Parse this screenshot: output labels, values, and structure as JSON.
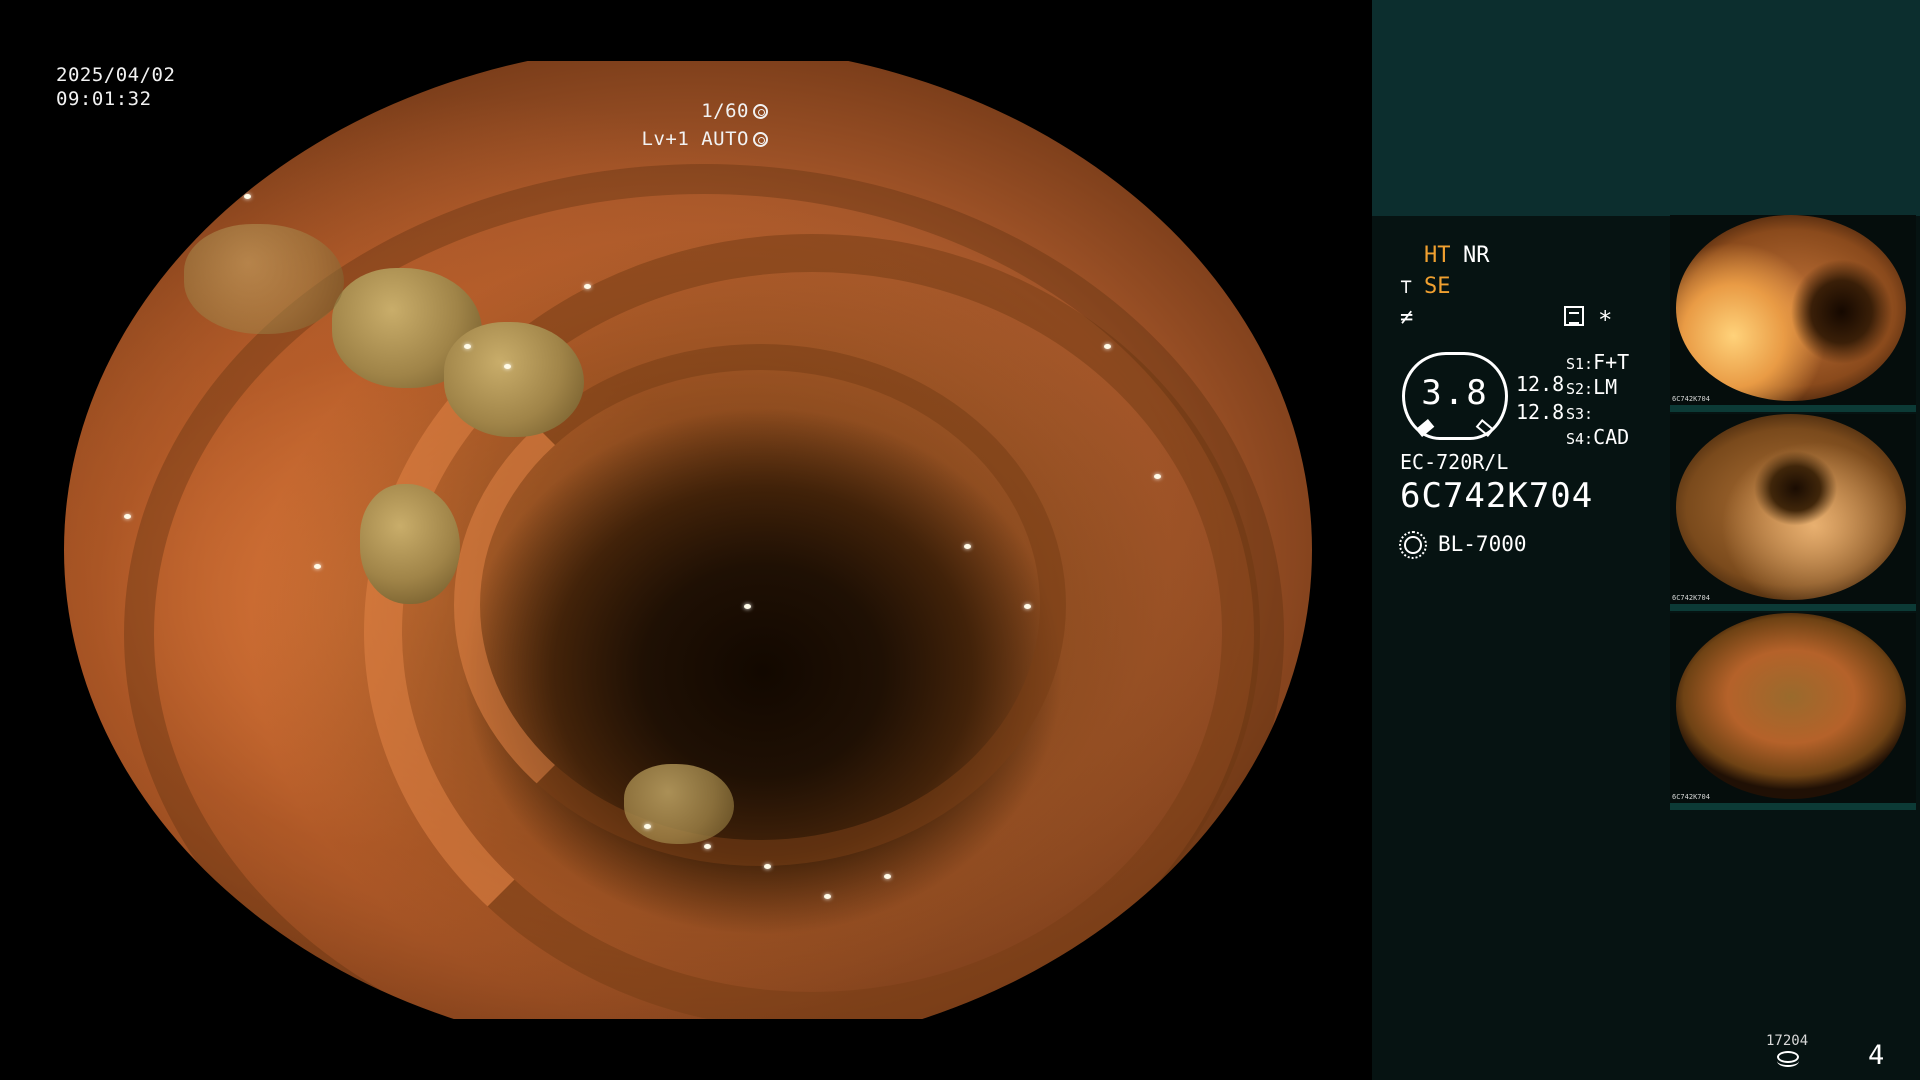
{
  "osd": {
    "date": "2025/04/02",
    "time": "09:01:32",
    "shutter": "1/60",
    "level": "Lv+1 AUTO"
  },
  "panel": {
    "ht": "HT",
    "nr": "NR",
    "se": "SE",
    "magnification": "3.8",
    "value_a": "12.8",
    "value_b": "12.8",
    "switches": [
      {
        "key": "S1:",
        "value": "F+T"
      },
      {
        "key": "S2:",
        "value": "LM"
      },
      {
        "key": "S3:",
        "value": ""
      },
      {
        "key": "S4:",
        "value": "CAD"
      }
    ],
    "scope_model": "EC-720R/L",
    "scope_serial": "6C742K704",
    "light_source": "BL-7000",
    "thumbnails": [
      {
        "serial": "6C742K704"
      },
      {
        "serial": "6C742K704"
      },
      {
        "serial": "6C742K704"
      }
    ],
    "image_count": "17204",
    "page_number": "4"
  },
  "colors": {
    "panel_bg": "#061312",
    "panel_header": "#0c2e2e",
    "accent_orange": "#f0a030"
  }
}
